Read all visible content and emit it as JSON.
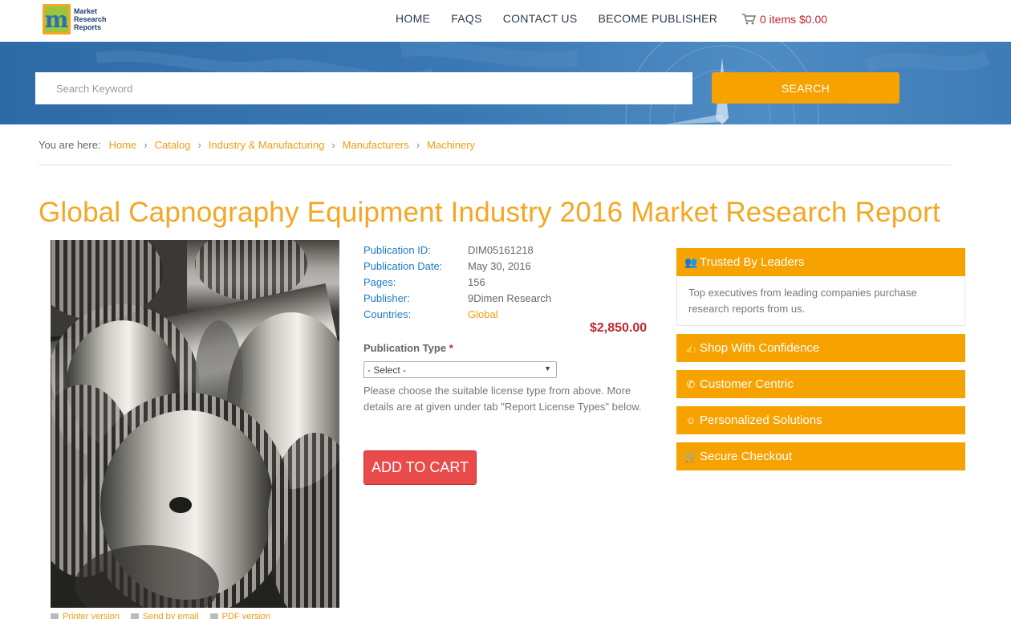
{
  "header": {
    "logo_lines": [
      "Market",
      "Research",
      "Reports"
    ],
    "nav": [
      "HOME",
      "FAQS",
      "CONTACT US",
      "BECOME PUBLISHER"
    ],
    "cart": "0 items $0.00"
  },
  "search": {
    "placeholder": "Search Keyword",
    "button": "SEARCH"
  },
  "breadcrumb": {
    "label": "You are here:",
    "items": [
      "Home",
      "Catalog",
      "Industry & Manufacturing",
      "Manufacturers",
      "Machinery"
    ]
  },
  "title": "Global Capnography Equipment Industry 2016 Market Research Report",
  "details": [
    {
      "key": "Publication ID:",
      "value": "DIM05161218"
    },
    {
      "key": "Publication Date:",
      "value": "May 30, 2016"
    },
    {
      "key": "Pages:",
      "value": "156"
    },
    {
      "key": "Publisher:",
      "value": "9Dimen Research"
    },
    {
      "key": "Countries:",
      "value": "Global"
    }
  ],
  "price": "$2,850.00",
  "publication_type": {
    "label": "Publication Type",
    "required_mark": "*",
    "selected": "- Select -",
    "help": "Please choose the suitable license type from above. More details are at given under tab \"Report License Types\" below."
  },
  "add_to_cart": "ADD TO CART",
  "footer_links": [
    "Printer version",
    "Send by email",
    "PDF version"
  ],
  "sidebar": {
    "trusted": {
      "title": "Trusted By Leaders",
      "text": "Top executives from leading companies purchase research reports from us."
    },
    "items": [
      "Shop With Confidence",
      "Customer Centric",
      "Personalized Solutions",
      "Secure Checkout"
    ]
  },
  "colors": {
    "accent": "#f6a200",
    "title": "#f5a623",
    "link": "#f39c12",
    "price": "#c0262d",
    "key": "#1c7cc8",
    "banner": "#3a78b4"
  }
}
